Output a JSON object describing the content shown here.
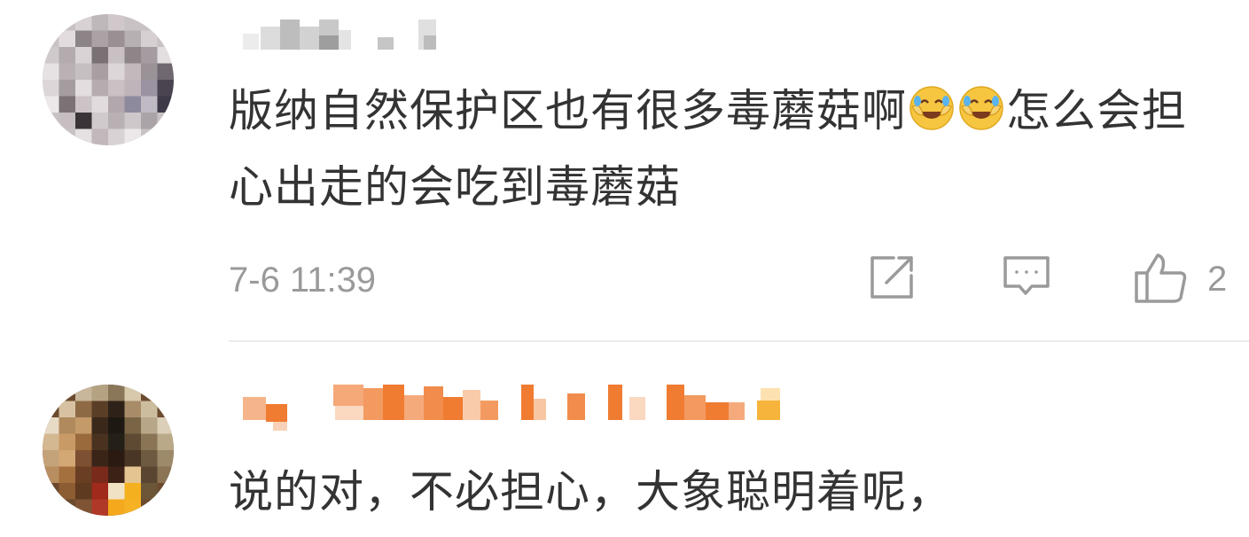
{
  "comments": [
    {
      "text_part1": "版纳自然保护区也有很多毒蘑菇啊",
      "emojis": [
        "laugh-cry-emoji",
        "laugh-cry-emoji"
      ],
      "text_part2": "怎么会担心出走的会吃到毒蘑菇",
      "time": "7-6 11:39",
      "likes": "2"
    },
    {
      "text": "说的对，不必担心，大象聪明着呢，"
    }
  ],
  "icons": {
    "share": "share-icon",
    "comment": "comment-icon",
    "like": "thumbs-up-icon"
  },
  "colors": {
    "text": "#333333",
    "meta": "#9a9a9a",
    "username_orange": "#f07c32"
  }
}
